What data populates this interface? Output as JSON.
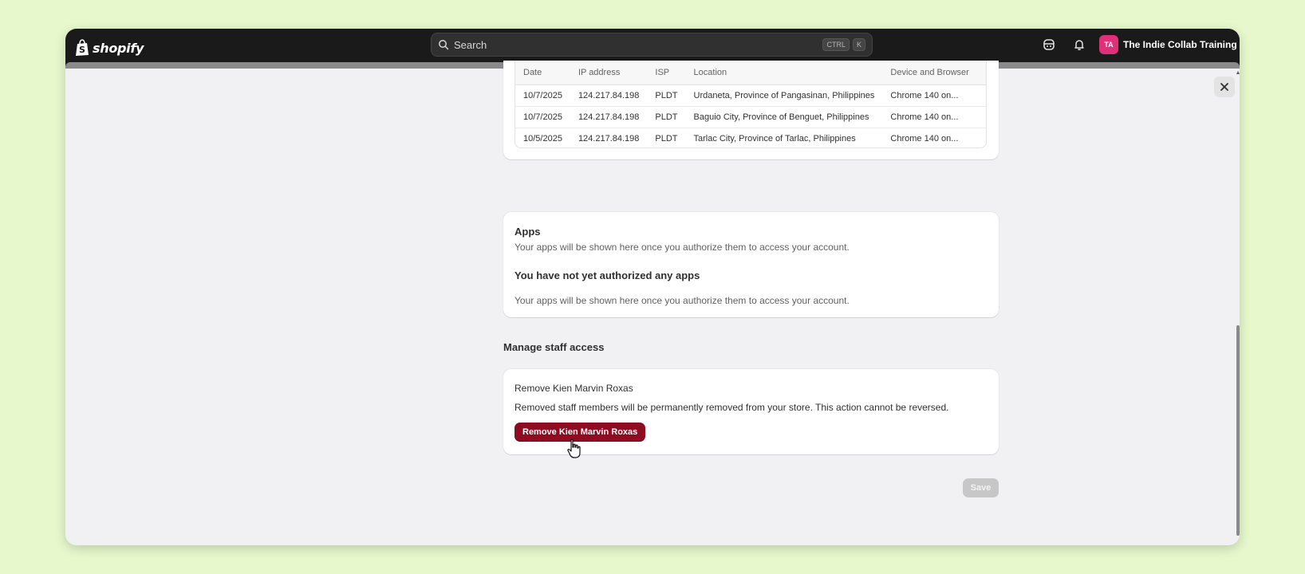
{
  "topbar": {
    "brand": "shopify",
    "search_placeholder": "Search",
    "shortcut_keys": [
      "CTRL",
      "K"
    ],
    "store_initials": "TA",
    "store_name": "The Indie Collab Training ..."
  },
  "sessions": {
    "columns": [
      "Date",
      "IP address",
      "ISP",
      "Location",
      "Device and Browser"
    ],
    "rows": [
      [
        "10/7/2025",
        "124.217.84.198",
        "PLDT",
        "Urdaneta, Province of Pangasinan, Philippines",
        "Chrome 140 on..."
      ],
      [
        "10/7/2025",
        "124.217.84.198",
        "PLDT",
        "Baguio City, Province of Benguet, Philippines",
        "Chrome 140 on..."
      ],
      [
        "10/5/2025",
        "124.217.84.198",
        "PLDT",
        "Tarlac City, Province of Tarlac, Philippines",
        "Chrome 140 on..."
      ]
    ]
  },
  "apps": {
    "title": "Apps",
    "description": "Your apps will be shown here once you authorize them to access your account.",
    "empty_title": "You have not yet authorized any apps",
    "empty_description": "Your apps will be shown here once you authorize them to access your account."
  },
  "manage_staff": {
    "heading": "Manage staff access",
    "card_title": "Remove Kien Marvin Roxas",
    "card_description": "Removed staff members will be permanently removed from your store. This action cannot be reversed.",
    "remove_button": "Remove Kien Marvin Roxas"
  },
  "footer": {
    "save_label": "Save"
  },
  "colors": {
    "page_background": "#e6f8cc",
    "topbar": "#1a1a1a",
    "avatar": "#e0307a",
    "destructive": "#8e0b21",
    "disabled": "#c7c7c7"
  }
}
